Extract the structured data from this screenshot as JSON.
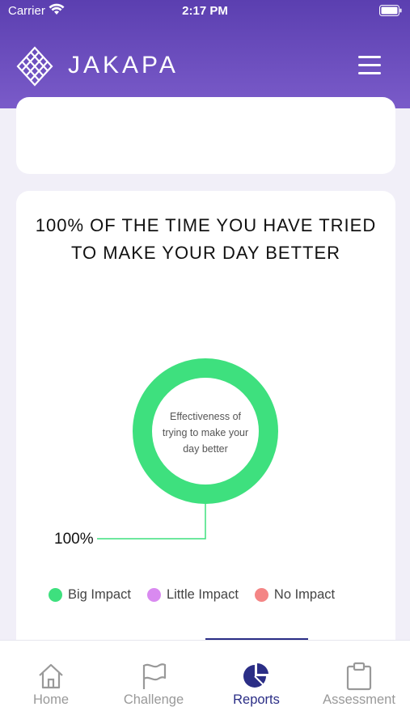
{
  "status_bar": {
    "carrier": "Carrier",
    "time": "2:17 PM"
  },
  "header": {
    "brand": "JAKAPA",
    "menu_icon": "hamburger-menu-icon"
  },
  "report": {
    "title": "100% OF THE TIME YOU HAVE TRIED TO MAKE YOUR DAY BETTER",
    "donut_label": "Effectiveness of trying to make your day better",
    "percent_label": "100%",
    "chart_data": {
      "type": "pie",
      "title": "Effectiveness of trying to make your day better",
      "categories": [
        "Big Impact",
        "Little Impact",
        "No Impact"
      ],
      "values": [
        100,
        0,
        0
      ],
      "colors": [
        "#3ee07e",
        "#d98af0",
        "#f48585"
      ]
    },
    "legend": [
      {
        "label": "Big Impact",
        "color": "#3ee07e"
      },
      {
        "label": "Little Impact",
        "color": "#d98af0"
      },
      {
        "label": "No Impact",
        "color": "#f48585"
      }
    ]
  },
  "tabs": [
    {
      "label": "Home",
      "icon": "home-icon"
    },
    {
      "label": "Challenge",
      "icon": "flag-icon"
    },
    {
      "label": "Reports",
      "icon": "pie-chart-icon",
      "active": true
    },
    {
      "label": "Assessment",
      "icon": "clipboard-icon"
    }
  ],
  "colors": {
    "brand": "#5b3fb0",
    "accent": "#2b2e86"
  }
}
